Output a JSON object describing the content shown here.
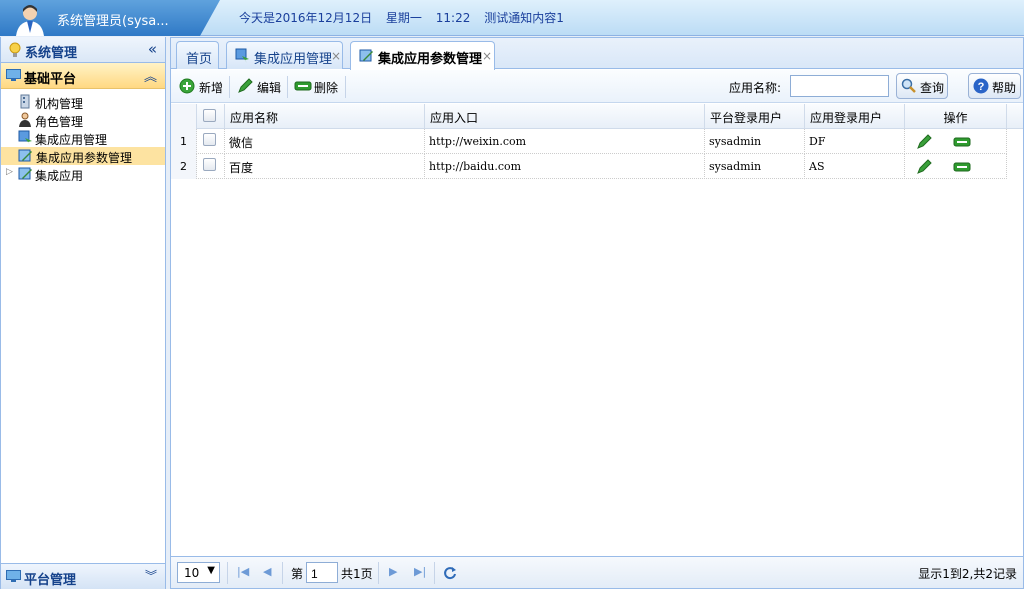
{
  "header": {
    "admin_name": "系统管理员(sysa...",
    "date_text": "今天是2016年12月12日",
    "weekday": "星期一",
    "time": "11:22",
    "notice": "测试通知内容1"
  },
  "sidebar": {
    "title": "系统管理",
    "collapse_glyph": "«",
    "section_open": {
      "label": "基础平台",
      "toggle_glyph": "︽",
      "items": [
        {
          "label": "机构管理",
          "icon": "building-icon"
        },
        {
          "label": "角色管理",
          "icon": "user-role-icon"
        },
        {
          "label": "集成应用管理",
          "icon": "app-manage-icon"
        },
        {
          "label": "集成应用参数管理",
          "icon": "app-param-icon",
          "selected": true
        },
        {
          "label": "集成应用",
          "icon": "app-icon",
          "expandable": true
        }
      ]
    },
    "section_closed": {
      "label": "平台管理",
      "toggle_glyph": "︾"
    }
  },
  "tabs": [
    {
      "label": "首页",
      "closable": false
    },
    {
      "label": "集成应用管理",
      "closable": true,
      "close_glyph": "×"
    },
    {
      "label": "集成应用参数管理",
      "closable": true,
      "active": true,
      "close_glyph": "×"
    }
  ],
  "toolbar": {
    "add_label": "新增",
    "edit_label": "编辑",
    "delete_label": "删除",
    "search_label": "应用名称:",
    "search_value": "",
    "query_label": "查询",
    "help_label": "帮助"
  },
  "grid": {
    "columns": [
      "应用名称",
      "应用入口",
      "平台登录用户",
      "应用登录用户",
      "操作"
    ],
    "rows": [
      {
        "num": "1",
        "name": "微信",
        "entry": "http://weixin.com",
        "platform_user": "sysadmin",
        "app_user": "DF"
      },
      {
        "num": "2",
        "name": "百度",
        "entry": "http://baidu.com",
        "platform_user": "sysadmin",
        "app_user": "AS"
      }
    ]
  },
  "pager": {
    "page_size": "10",
    "page_prefix": "第",
    "page_value": "1",
    "page_suffix": "共1页",
    "info": "显示1到2,共2记录"
  },
  "colors": {
    "header_blue": "#2f79c6",
    "border": "#99bbe8",
    "selected_bg": "#fde3a1",
    "accent_green": "#2f9b2f"
  }
}
